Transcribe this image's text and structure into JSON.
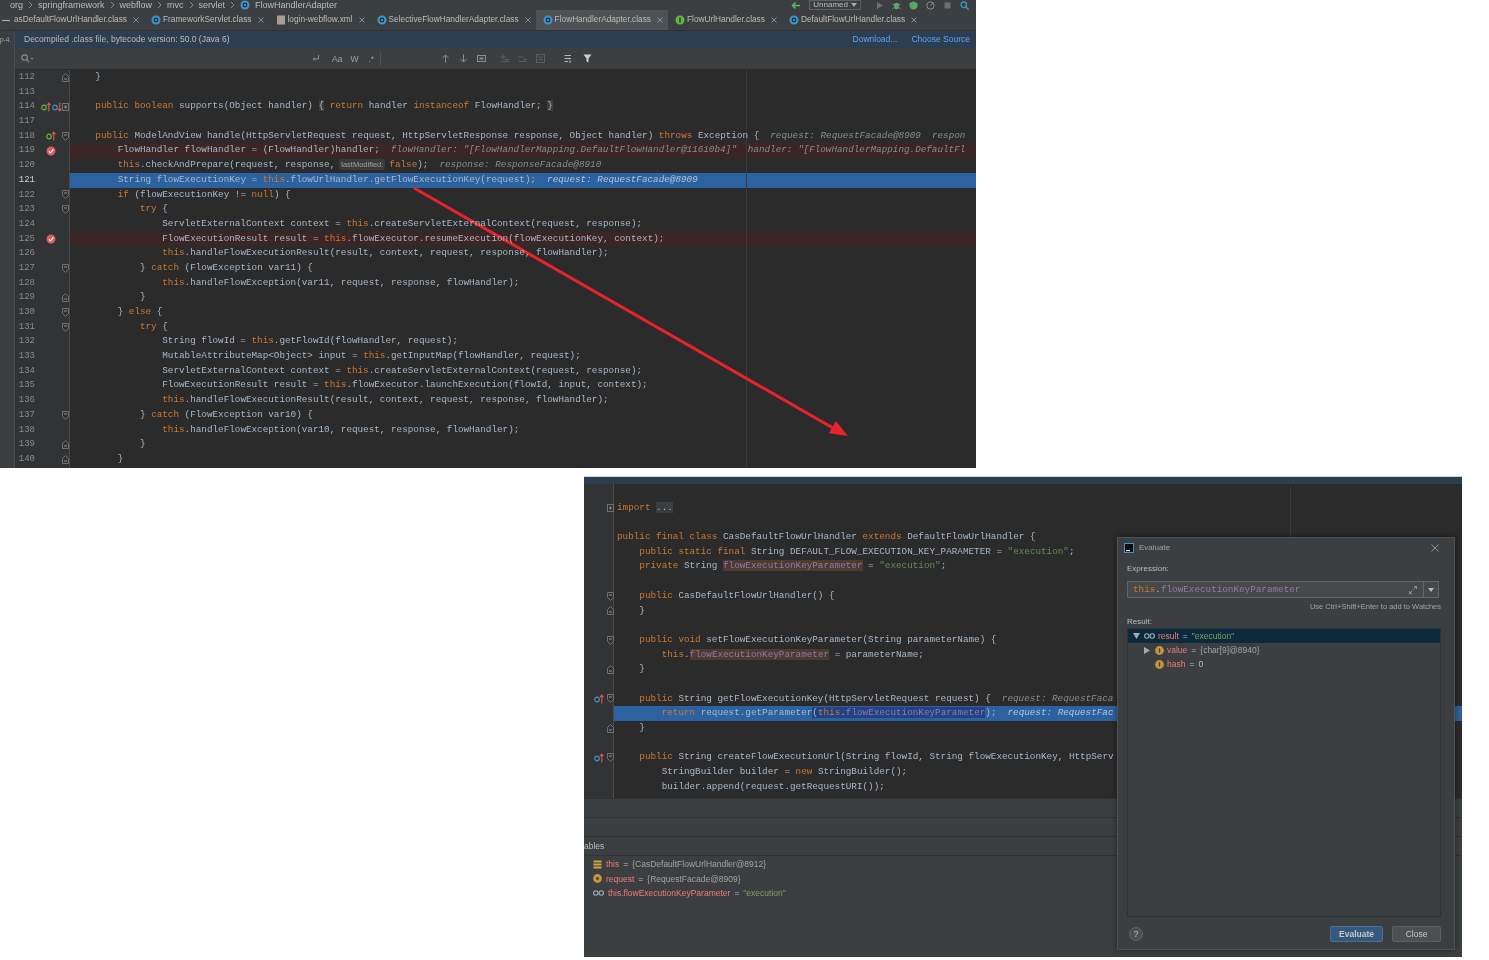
{
  "editor_screenshot": {
    "navigation_bar": {
      "breadcrumbs": [
        {
          "label": "org",
          "kind": "package"
        },
        {
          "label": "springframework",
          "kind": "package"
        },
        {
          "label": "webflow",
          "kind": "package"
        },
        {
          "label": "mvc",
          "kind": "package"
        },
        {
          "label": "servlet",
          "kind": "package"
        },
        {
          "label": "FlowHandlerAdapter",
          "kind": "class"
        }
      ],
      "run_configuration": "Unnamed"
    },
    "editor_tabs": [
      {
        "label": "asDefaultFlowUrlHandler.class",
        "kind": "partial",
        "selected": false
      },
      {
        "label": "FrameworkServlet.class",
        "kind": "class",
        "selected": false
      },
      {
        "label": "login-webflow.xml",
        "kind": "xml",
        "selected": false
      },
      {
        "label": "SelectiveFlowHandlerAdapter.class",
        "kind": "class",
        "selected": false
      },
      {
        "label": "FlowHandlerAdapter.class",
        "kind": "class",
        "selected": true
      },
      {
        "label": "FlowUrlHandler.class",
        "kind": "interface",
        "selected": false
      },
      {
        "label": "DefaultFlowUrlHandler.class",
        "kind": "class",
        "selected": false
      }
    ],
    "project_pane": {
      "label": "p-4."
    },
    "decompiled_notice": {
      "text": "Decompiled .class file, bytecode version: 50.0 (Java 6)",
      "links": [
        "Download...",
        "Choose Source"
      ]
    },
    "find_bar": {
      "options": [
        "Aa",
        "W",
        ".*"
      ]
    },
    "editor": {
      "lines": [
        {
          "number": "112",
          "fold": {
            "kind": "close"
          },
          "breakpoint": false,
          "current": false,
          "segments": [
            {
              "kind": "plain",
              "text": "    }"
            }
          ]
        },
        {
          "number": "113",
          "breakpoint": false,
          "current": false
        },
        {
          "number": "114",
          "fold": {
            "kind": "folded"
          },
          "gutter": [
            {
              "kind": "implements"
            },
            {
              "kind": "overridden"
            }
          ],
          "breakpoint": false,
          "current": false,
          "segments": [
            {
              "kind": "keyword",
              "text": "    public boolean"
            },
            {
              "kind": "plain",
              "text": " supports(Object handler) "
            },
            {
              "kind": "fold",
              "text": "{"
            },
            {
              "kind": "keyword",
              "text": " return"
            },
            {
              "kind": "plain",
              "text": " handler "
            },
            {
              "kind": "keyword",
              "text": "instanceof"
            },
            {
              "kind": "plain",
              "text": " FlowHandler; "
            },
            {
              "kind": "fold",
              "text": "}"
            }
          ]
        },
        {
          "number": "117",
          "breakpoint": false,
          "current": false
        },
        {
          "number": "118",
          "fold": {
            "kind": "open"
          },
          "gutter": [
            {
              "kind": "implements"
            }
          ],
          "breakpoint": false,
          "current": false,
          "segments": [
            {
              "kind": "keyword",
              "text": "    public"
            },
            {
              "kind": "plain",
              "text": " ModelAndView handle(HttpServletRequest request, HttpServletResponse response, Object handler) "
            },
            {
              "kind": "keyword",
              "text": "throws"
            },
            {
              "kind": "plain",
              "text": " Exception {"
            },
            {
              "kind": "hint",
              "text": "request: RequestFacade@8909"
            },
            {
              "kind": "hint",
              "text": "respon"
            }
          ]
        },
        {
          "number": "119",
          "breakpoint": true,
          "current": false,
          "segments": [
            {
              "kind": "plain",
              "text": "        FlowHandler flowHandler = (FlowHandler)handler;"
            },
            {
              "kind": "hint",
              "text": "flowHandler: \"[FlowHandlerMapping.DefaultFlowHandler@11610b4]\""
            },
            {
              "kind": "hint",
              "text": "handler: \"[FlowHandlerMapping.DefaultFl"
            }
          ]
        },
        {
          "number": "120",
          "breakpoint": false,
          "current": false,
          "segments": [
            {
              "kind": "keyword",
              "text": "        this"
            },
            {
              "kind": "plain",
              "text": ".checkAndPrepare(request, response,"
            },
            {
              "kind": "paramhint",
              "text": "lastModified:"
            },
            {
              "kind": "keyword",
              "text": "false"
            },
            {
              "kind": "plain",
              "text": ");"
            },
            {
              "kind": "hint",
              "text": "response: ResponseFacade@8910"
            }
          ]
        },
        {
          "number": "121",
          "breakpoint": false,
          "current": true,
          "segments": [
            {
              "kind": "plain",
              "text": "        String flowExecutionKey = "
            },
            {
              "kind": "keyword",
              "text": "this"
            },
            {
              "kind": "plain",
              "text": ".flowUrlHandler.getFlowExecutionKey(request);"
            },
            {
              "kind": "hint",
              "text": "request: RequestFacade@8909"
            }
          ]
        },
        {
          "number": "122",
          "fold": {
            "kind": "open"
          },
          "breakpoint": false,
          "current": false,
          "segments": [
            {
              "kind": "keyword",
              "text": "        if"
            },
            {
              "kind": "plain",
              "text": " (flowExecutionKey != "
            },
            {
              "kind": "keyword",
              "text": "null"
            },
            {
              "kind": "plain",
              "text": ") {"
            }
          ]
        },
        {
          "number": "123",
          "fold": {
            "kind": "open"
          },
          "breakpoint": false,
          "current": false,
          "segments": [
            {
              "kind": "keyword",
              "text": "            try"
            },
            {
              "kind": "plain",
              "text": " {"
            }
          ]
        },
        {
          "number": "124",
          "breakpoint": false,
          "current": false,
          "segments": [
            {
              "kind": "plain",
              "text": "                ServletExternalContext context = "
            },
            {
              "kind": "keyword",
              "text": "this"
            },
            {
              "kind": "plain",
              "text": ".createServletExternalContext(request, response);"
            }
          ]
        },
        {
          "number": "125",
          "breakpoint": true,
          "current": false,
          "segments": [
            {
              "kind": "plain",
              "text": "                FlowExecutionResult result = "
            },
            {
              "kind": "keyword",
              "text": "this"
            },
            {
              "kind": "plain",
              "text": ".flowExecutor.resumeExecution(flowExecutionKey, context);"
            }
          ]
        },
        {
          "number": "126",
          "breakpoint": false,
          "current": false,
          "segments": [
            {
              "kind": "keyword",
              "text": "                this"
            },
            {
              "kind": "plain",
              "text": ".handleFlowExecutionResult(result, context, request, response, flowHandler);"
            }
          ]
        },
        {
          "number": "127",
          "fold": {
            "kind": "open"
          },
          "breakpoint": false,
          "current": false,
          "segments": [
            {
              "kind": "plain",
              "text": "            } "
            },
            {
              "kind": "keyword",
              "text": "catch"
            },
            {
              "kind": "plain",
              "text": " (FlowException var11) {"
            }
          ]
        },
        {
          "number": "128",
          "breakpoint": false,
          "current": false,
          "segments": [
            {
              "kind": "keyword",
              "text": "                this"
            },
            {
              "kind": "plain",
              "text": ".handleFlowException(var11, request, response, flowHandler);"
            }
          ]
        },
        {
          "number": "129",
          "fold": {
            "kind": "close"
          },
          "breakpoint": false,
          "current": false,
          "segments": [
            {
              "kind": "plain",
              "text": "            }"
            }
          ]
        },
        {
          "number": "130",
          "fold": {
            "kind": "open"
          },
          "breakpoint": false,
          "current": false,
          "segments": [
            {
              "kind": "plain",
              "text": "        } "
            },
            {
              "kind": "keyword",
              "text": "else"
            },
            {
              "kind": "plain",
              "text": " {"
            }
          ]
        },
        {
          "number": "131",
          "fold": {
            "kind": "open"
          },
          "breakpoint": false,
          "current": false,
          "segments": [
            {
              "kind": "keyword",
              "text": "            try"
            },
            {
              "kind": "plain",
              "text": " {"
            }
          ]
        },
        {
          "number": "132",
          "breakpoint": false,
          "current": false,
          "segments": [
            {
              "kind": "plain",
              "text": "                String flowId = "
            },
            {
              "kind": "keyword",
              "text": "this"
            },
            {
              "kind": "plain",
              "text": ".getFlowId(flowHandler, request);"
            }
          ]
        },
        {
          "number": "133",
          "breakpoint": false,
          "current": false,
          "segments": [
            {
              "kind": "plain",
              "text": "                MutableAttributeMap<Object> input = "
            },
            {
              "kind": "keyword",
              "text": "this"
            },
            {
              "kind": "plain",
              "text": ".getInputMap(flowHandler, request);"
            }
          ]
        },
        {
          "number": "134",
          "breakpoint": false,
          "current": false,
          "segments": [
            {
              "kind": "plain",
              "text": "                ServletExternalContext context = "
            },
            {
              "kind": "keyword",
              "text": "this"
            },
            {
              "kind": "plain",
              "text": ".createServletExternalContext(request, response);"
            }
          ]
        },
        {
          "number": "135",
          "breakpoint": false,
          "current": false,
          "segments": [
            {
              "kind": "plain",
              "text": "                FlowExecutionResult result = "
            },
            {
              "kind": "keyword",
              "text": "this"
            },
            {
              "kind": "plain",
              "text": ".flowExecutor.launchExecution(flowId, input, context);"
            }
          ]
        },
        {
          "number": "136",
          "breakpoint": false,
          "current": false,
          "segments": [
            {
              "kind": "keyword",
              "text": "                this"
            },
            {
              "kind": "plain",
              "text": ".handleFlowExecutionResult(result, context, request, response, flowHandler);"
            }
          ]
        },
        {
          "number": "137",
          "fold": {
            "kind": "open"
          },
          "breakpoint": false,
          "current": false,
          "segments": [
            {
              "kind": "plain",
              "text": "            } "
            },
            {
              "kind": "keyword",
              "text": "catch"
            },
            {
              "kind": "plain",
              "text": " (FlowException var10) {"
            }
          ]
        },
        {
          "number": "138",
          "breakpoint": false,
          "current": false,
          "segments": [
            {
              "kind": "keyword",
              "text": "                this"
            },
            {
              "kind": "plain",
              "text": ".handleFlowException(var10, request, response, flowHandler);"
            }
          ]
        },
        {
          "number": "139",
          "fold": {
            "kind": "close"
          },
          "breakpoint": false,
          "current": false,
          "segments": [
            {
              "kind": "plain",
              "text": "            }"
            }
          ]
        },
        {
          "number": "140",
          "fold": {
            "kind": "close"
          },
          "breakpoint": false,
          "current": false,
          "segments": [
            {
              "kind": "plain",
              "text": "        }"
            }
          ]
        }
      ]
    }
  },
  "debugger_screenshot": {
    "editor": {
      "lines": [
        {
          "breakpoint": false,
          "current": false
        },
        {
          "fold": {
            "kind": "folded"
          },
          "breakpoint": false,
          "current": false,
          "segments": [
            {
              "kind": "keyword",
              "text": "import "
            },
            {
              "kind": "fold",
              "text": "..."
            }
          ]
        },
        {
          "breakpoint": false,
          "current": false
        },
        {
          "breakpoint": false,
          "current": false,
          "segments": [
            {
              "kind": "keyword",
              "text": "public final class"
            },
            {
              "kind": "plain",
              "text": " CasDefaultFlowUrlHandler "
            },
            {
              "kind": "keyword",
              "text": "extends"
            },
            {
              "kind": "plain",
              "text": " DefaultFlowUrlHandler {"
            }
          ]
        },
        {
          "breakpoint": false,
          "current": false,
          "segments": [
            {
              "kind": "keyword",
              "text": "    public static final"
            },
            {
              "kind": "plain",
              "text": " String DEFAULT_FLOW_EXECUTION_KEY_PARAMETER = "
            },
            {
              "kind": "string",
              "text": "\"execution\""
            },
            {
              "kind": "plain",
              "text": ";"
            }
          ]
        },
        {
          "breakpoint": false,
          "current": false,
          "segments": [
            {
              "kind": "keyword",
              "text": "    private"
            },
            {
              "kind": "plain",
              "text": " String "
            },
            {
              "kind": "usage",
              "text": "flowExecutionKeyParameter"
            },
            {
              "kind": "plain",
              "text": " = "
            },
            {
              "kind": "string",
              "text": "\"execution\""
            },
            {
              "kind": "plain",
              "text": ";"
            }
          ]
        },
        {
          "breakpoint": false,
          "current": false
        },
        {
          "fold": {
            "kind": "open"
          },
          "breakpoint": false,
          "current": false,
          "segments": [
            {
              "kind": "keyword",
              "text": "    public"
            },
            {
              "kind": "plain",
              "text": " CasDefaultFlowUrlHandler() {"
            }
          ]
        },
        {
          "fold": {
            "kind": "close"
          },
          "breakpoint": false,
          "current": false,
          "segments": [
            {
              "kind": "plain",
              "text": "    }"
            }
          ]
        },
        {
          "breakpoint": false,
          "current": false
        },
        {
          "fold": {
            "kind": "open"
          },
          "breakpoint": false,
          "current": false,
          "segments": [
            {
              "kind": "keyword",
              "text": "    public void"
            },
            {
              "kind": "plain",
              "text": " setFlowExecutionKeyParameter(String parameterName) {"
            }
          ]
        },
        {
          "breakpoint": false,
          "current": false,
          "segments": [
            {
              "kind": "keyword",
              "text": "        this"
            },
            {
              "kind": "plain",
              "text": "."
            },
            {
              "kind": "usage",
              "text": "flowExecutionKeyParameter"
            },
            {
              "kind": "plain",
              "text": " = parameterName;"
            }
          ]
        },
        {
          "fold": {
            "kind": "close"
          },
          "breakpoint": false,
          "current": false,
          "segments": [
            {
              "kind": "plain",
              "text": "    }"
            }
          ]
        },
        {
          "breakpoint": false,
          "current": false
        },
        {
          "fold": {
            "kind": "open"
          },
          "gutter": [
            {
              "kind": "overrides"
            }
          ],
          "breakpoint": false,
          "current": false,
          "segments": [
            {
              "kind": "keyword",
              "text": "    public"
            },
            {
              "kind": "plain",
              "text": " String getFlowExecutionKey(HttpServletRequest request) {"
            },
            {
              "kind": "hint",
              "text": "request: RequestFaca"
            }
          ]
        },
        {
          "breakpoint": false,
          "current": true,
          "segments": [
            {
              "kind": "keyword",
              "text": "        return"
            },
            {
              "kind": "plain",
              "text": " request.getParameter"
            },
            {
              "kind": "selplain",
              "text": "("
            },
            {
              "kind": "selkeyword",
              "text": "this"
            },
            {
              "kind": "selplain",
              "text": "."
            },
            {
              "kind": "selfield",
              "text": "flowExecutionKeyParameter"
            },
            {
              "kind": "plain",
              "text": ");"
            },
            {
              "kind": "hint",
              "text": "request: RequestFac"
            }
          ]
        },
        {
          "fold": {
            "kind": "close"
          },
          "breakpoint": false,
          "current": false,
          "segments": [
            {
              "kind": "plain",
              "text": "    }"
            }
          ]
        },
        {
          "breakpoint": false,
          "current": false
        },
        {
          "fold": {
            "kind": "open"
          },
          "gutter": [
            {
              "kind": "overrides"
            }
          ],
          "breakpoint": false,
          "current": false,
          "segments": [
            {
              "kind": "keyword",
              "text": "    public"
            },
            {
              "kind": "plain",
              "text": " String createFlowExecutionUrl(String flowId, String flowExecutionKey, HttpServ"
            }
          ]
        },
        {
          "breakpoint": false,
          "current": false,
          "segments": [
            {
              "kind": "plain",
              "text": "        StringBuilder builder = "
            },
            {
              "kind": "keyword",
              "text": "new"
            },
            {
              "kind": "plain",
              "text": " StringBuilder();"
            }
          ]
        },
        {
          "breakpoint": false,
          "current": false,
          "segments": [
            {
              "kind": "plain",
              "text": "        builder.append(request.getRequestURI());"
            }
          ]
        }
      ]
    },
    "variables": {
      "title": "ables",
      "items": [
        {
          "kind": "object",
          "name": "this",
          "operator": "=",
          "value": {
            "kind": "object",
            "text": "{CasDefaultFlowUrlHandler@8912}"
          }
        },
        {
          "kind": "parameter",
          "name": "request",
          "operator": "=",
          "value": {
            "kind": "object",
            "text": "{RequestFacade@8909}"
          }
        },
        {
          "kind": "watch",
          "name": "this.flowExecutionKeyParameter",
          "operator": "=",
          "value": {
            "kind": "string",
            "text": "\"execution\""
          }
        }
      ]
    },
    "evaluate_dialog": {
      "title": "Evaluate",
      "expression_label": "Expression:",
      "expression": [
        {
          "kind": "keyword",
          "text": "this"
        },
        {
          "kind": "plain",
          "text": "."
        },
        {
          "kind": "field",
          "text": "flowExecutionKeyParameter"
        }
      ],
      "shortcut_hint": "Use Ctrl+Shift+Enter to add to Watches",
      "result_label": "Result:",
      "result": [
        {
          "kind": "watch",
          "name": "result",
          "operator": "=",
          "value": {
            "kind": "string",
            "text": "\"execution\""
          },
          "expanded": true,
          "selected": true,
          "children": [
            {
              "kind": "field",
              "name": "value",
              "operator": "=",
              "value": {
                "kind": "object",
                "text": "{char[9]@8940}"
              },
              "expanded": false,
              "selected": false
            },
            {
              "kind": "field",
              "name": "hash",
              "operator": "=",
              "value": {
                "kind": "number",
                "text": "0"
              },
              "selected": false
            }
          ]
        }
      ],
      "help_label": "?",
      "buttons": [
        {
          "label": "Evaluate",
          "kind": "primary"
        },
        {
          "label": "Close",
          "kind": "secondary"
        }
      ]
    }
  }
}
